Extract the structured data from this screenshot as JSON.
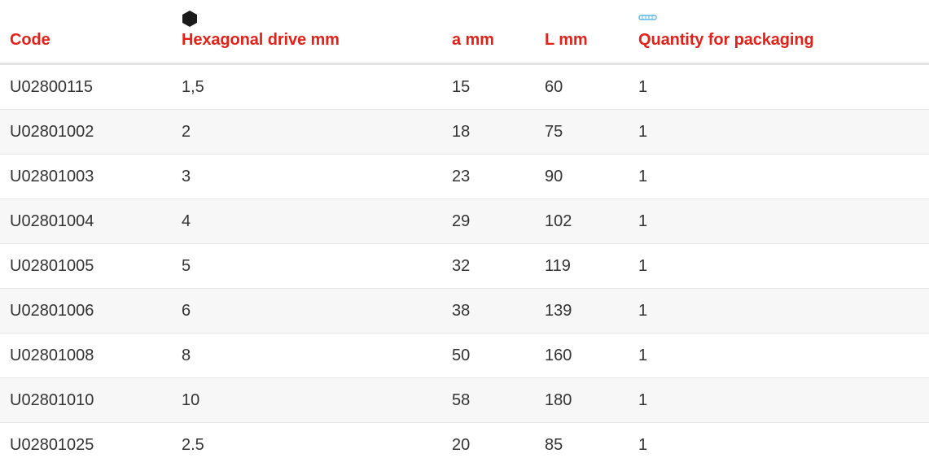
{
  "header": {
    "columns": [
      "Code",
      "Hexagonal drive mm",
      "a mm",
      "L mm",
      "Quantity for packaging"
    ],
    "icons": {
      "hex": "hexagon-icon",
      "packaging": "packaging-icon"
    },
    "colors": {
      "header_text": "#e32119",
      "hex_icon": "#1a1a1a",
      "packaging_icon": "#5bb8e8"
    }
  },
  "rows": [
    [
      "U02800115",
      "1,5",
      "15",
      "60",
      "1"
    ],
    [
      "U02801002",
      "2",
      "18",
      "75",
      "1"
    ],
    [
      "U02801003",
      "3",
      "23",
      "90",
      "1"
    ],
    [
      "U02801004",
      "4",
      "29",
      "102",
      "1"
    ],
    [
      "U02801005",
      "5",
      "32",
      "119",
      "1"
    ],
    [
      "U02801006",
      "6",
      "38",
      "139",
      "1"
    ],
    [
      "U02801008",
      "8",
      "50",
      "160",
      "1"
    ],
    [
      "U02801010",
      "10",
      "58",
      "180",
      "1"
    ],
    [
      "U02801025",
      "2.5",
      "20",
      "85",
      "1"
    ]
  ]
}
